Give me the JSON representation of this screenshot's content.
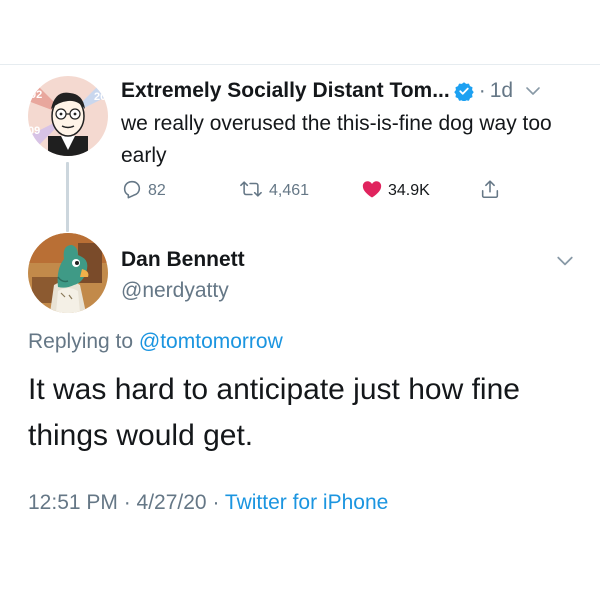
{
  "tweet1": {
    "author_name": "Extremely Socially Distant Tom...",
    "separator": "·",
    "time": "1d",
    "text": "we really overused the this-is-fine dog way too early",
    "replies": "82",
    "retweets": "4,461",
    "likes": "34.9K",
    "icons": [
      "verified-badge-icon",
      "chevron-down-icon",
      "reply-icon",
      "retweet-icon",
      "heart-icon",
      "share-icon"
    ]
  },
  "tweet2": {
    "author_name": "Dan Bennett",
    "handle": "@nerdyatty",
    "replying_prefix": "Replying to ",
    "replying_to": "@tomtomorrow",
    "text": "It was hard to anticipate just how fine things would get.",
    "timestamp": "12:51 PM · 4/27/20 · ",
    "client": "Twitter for iPhone"
  },
  "colors": {
    "link_blue": "#1b95e0",
    "like_red": "#e0245e",
    "secondary_gray": "#657786",
    "primary_text": "#14171a"
  }
}
